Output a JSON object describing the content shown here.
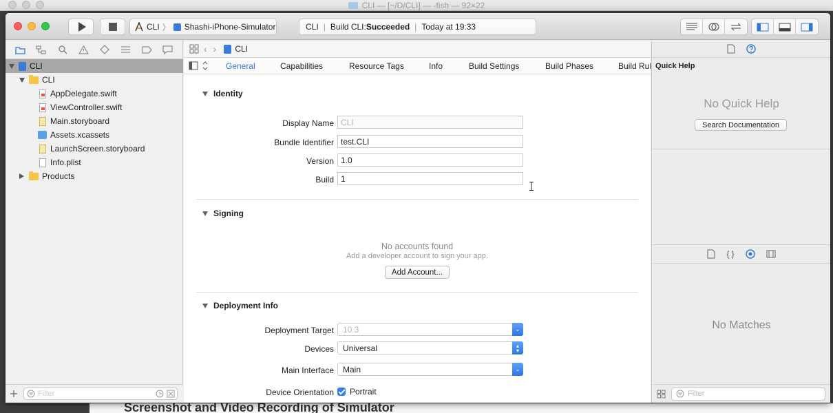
{
  "terminal": {
    "title": "CLI — [~/D/CLI] — -fish — 92×22",
    "behind_text": "Screenshot and Video Recording of Simulator"
  },
  "toolbar": {
    "scheme_project": "CLI",
    "scheme_separator": "〉",
    "scheme_device": "Shashi-iPhone-Simulator",
    "activity_target": "CLI",
    "activity_status_prefix": "Build CLI: ",
    "activity_status": "Succeeded",
    "activity_time": "Today at 19:33"
  },
  "navigator": {
    "project": "CLI",
    "group": "CLI",
    "files": [
      {
        "name": "AppDelegate.swift",
        "kind": "swift"
      },
      {
        "name": "ViewController.swift",
        "kind": "swift"
      },
      {
        "name": "Main.storyboard",
        "kind": "storyboard"
      },
      {
        "name": "Assets.xcassets",
        "kind": "assets"
      },
      {
        "name": "LaunchScreen.storyboard",
        "kind": "storyboard"
      },
      {
        "name": "Info.plist",
        "kind": "plist"
      }
    ],
    "products": "Products",
    "filter_placeholder": "Filter"
  },
  "editor": {
    "breadcrumb": "CLI",
    "tabs": [
      "General",
      "Capabilities",
      "Resource Tags",
      "Info",
      "Build Settings",
      "Build Phases",
      "Build Rules"
    ],
    "active_tab": "General",
    "identity": {
      "header": "Identity",
      "display_name_label": "Display Name",
      "display_name_value": "CLI",
      "bundle_identifier_label": "Bundle Identifier",
      "bundle_identifier_value": "test.CLI",
      "version_label": "Version",
      "version_value": "1.0",
      "build_label": "Build",
      "build_value": "1"
    },
    "signing": {
      "header": "Signing",
      "no_accounts": "No accounts found",
      "hint": "Add a developer account to sign your app.",
      "add_account": "Add Account..."
    },
    "deployment": {
      "header": "Deployment Info",
      "target_label": "Deployment Target",
      "target_value": "10.3",
      "devices_label": "Devices",
      "devices_value": "Universal",
      "interface_label": "Main Interface",
      "interface_value": "Main",
      "orientation_label": "Device Orientation",
      "orientation_portrait": "Portrait"
    }
  },
  "inspector": {
    "quick_help_title": "Quick Help",
    "no_quick_help": "No Quick Help",
    "search_documentation": "Search Documentation",
    "no_matches": "No Matches",
    "filter_placeholder": "Filter"
  },
  "colors": {
    "accent": "#2e77d4",
    "selection": "#a8a8a8"
  }
}
